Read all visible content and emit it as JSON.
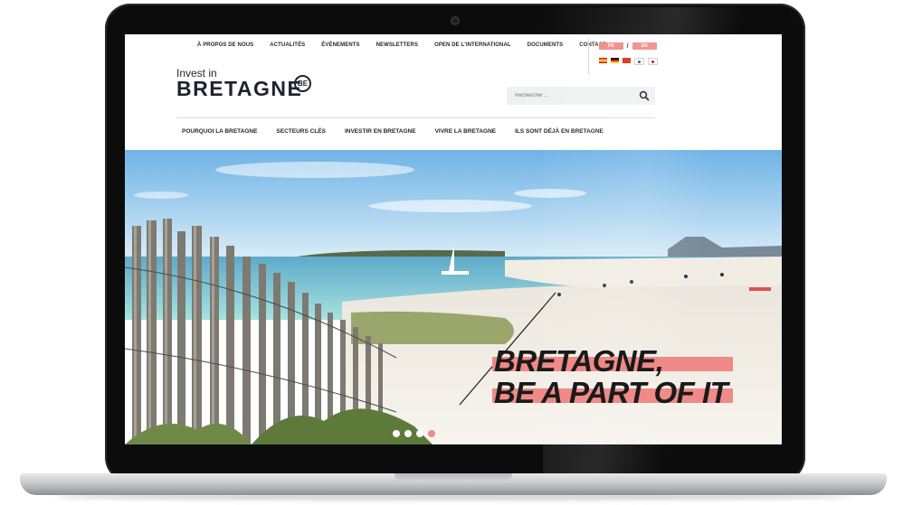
{
  "top_nav": [
    "À PROPOS DE NOUS",
    "ACTUALITÉS",
    "ÉVÉNEMENTS",
    "NEWSLETTERS",
    "OPEN DE L'INTERNATIONAL",
    "DOCUMENTS",
    "CONTACT"
  ],
  "languages": {
    "primary": "FR",
    "secondary": "EN",
    "separator": "/"
  },
  "logo": {
    "top": "Invest in",
    "main": "BRETAGNE",
    "badge": "BE"
  },
  "search": {
    "placeholder": "Rechercher ..."
  },
  "main_nav": [
    "POURQUOI LA BRETAGNE",
    "SECTEURS CLÉS",
    "INVESTIR EN BRETAGNE",
    "VIVRE LA BRETAGNE",
    "ILS SONT DÉJÀ EN BRETAGNE"
  ],
  "hero": {
    "line1": "BRETAGNE,",
    "line2": "BE A PART OF IT",
    "slide_count": 4,
    "active_slide": 4
  },
  "colors": {
    "accent": "#ef8a86",
    "text": "#1f2330",
    "sky": "#8ec3e8",
    "sea": "#7ecfd6",
    "sand": "#f2efe8"
  }
}
